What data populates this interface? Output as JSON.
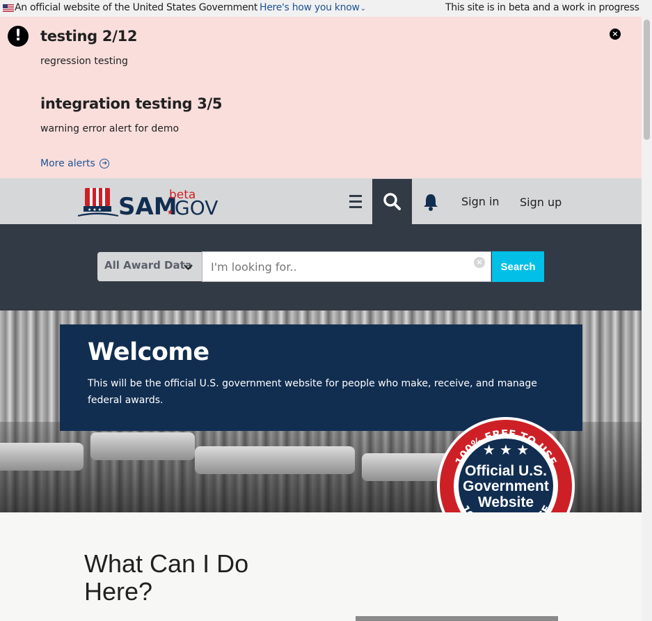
{
  "gov_banner": {
    "official_text": "An official website of the United States Government",
    "how_link": "Here's how you know",
    "beta_notice": "This site is in beta and a work in progress"
  },
  "alerts": {
    "items": [
      {
        "title": "testing 2/12",
        "body": "regression testing"
      },
      {
        "title": "integration testing 3/5",
        "body": "warning error alert for demo"
      }
    ],
    "more_label": "More alerts",
    "close_symbol": "×",
    "alert_symbol": "!"
  },
  "header": {
    "logo_sam": "SAM",
    "logo_gov": "GOV",
    "logo_beta": "beta",
    "sign_in": "Sign in",
    "sign_up": "Sign up"
  },
  "search": {
    "domain_select": "All Award Data",
    "placeholder": "I'm looking for..",
    "clear_symbol": "×",
    "button": "Search"
  },
  "hero": {
    "title": "Welcome",
    "text": "This will be the official U.S. government website for people who make, receive, and manage federal awards."
  },
  "seal": {
    "ring_text": "100% FREE TO USE",
    "line1": "Official U.S.",
    "line2": "Government",
    "line3": "Website"
  },
  "section": {
    "heading_line1": "What Can I Do",
    "heading_line2": "Here?"
  },
  "colors": {
    "alert_bg": "#f9dedc",
    "header_bg": "#d6d7d9",
    "dark": "#323a45",
    "navy": "#112e51",
    "cyan": "#02bfe7",
    "link": "#205493",
    "seal_red": "#cd2026"
  },
  "icons": {
    "flag": "us-flag-icon",
    "alert": "exclamation-icon",
    "close": "close-icon",
    "menu": "hamburger-icon",
    "search": "search-icon",
    "notifications": "bell-icon"
  }
}
